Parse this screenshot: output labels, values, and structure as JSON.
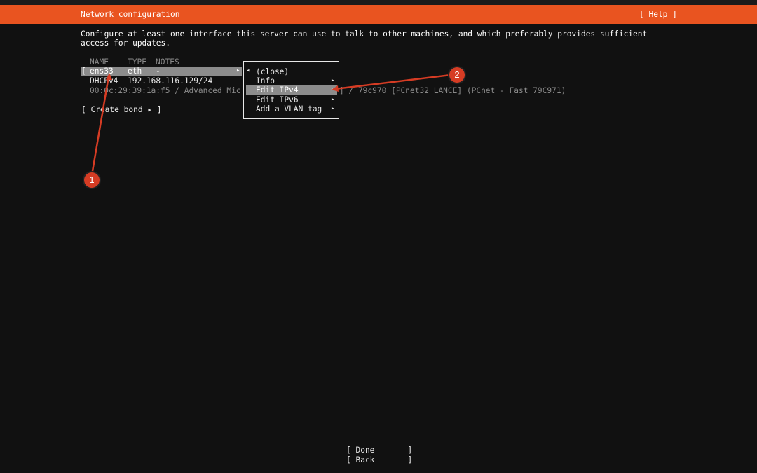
{
  "header": {
    "title": "Network configuration",
    "help": "[ Help ]"
  },
  "description": {
    "line1": "Configure at least one interface this server can use to talk to other machines, and which preferably provides sufficient",
    "line2": "access for updates."
  },
  "table": {
    "col_name": "NAME",
    "col_type": "TYPE",
    "col_notes": "NOTES",
    "interface": {
      "open_bracket": "[",
      "name": "ens33",
      "type": "eth",
      "notes": "-",
      "arrow": "▸"
    },
    "dhcp_label": "DHCPv4",
    "dhcp_address": "192.168.116.129/24",
    "mac_line_left": "00:0c:29:39:1a:f5 / Advanced Mic",
    "mac_line_right": "] / 79c970 [PCnet32 LANCE] (PCnet - Fast 79C971)"
  },
  "create_bond": "[ Create bond ▸ ]",
  "popup": {
    "close_arrow": "◂",
    "items": [
      {
        "label": "(close)",
        "arrow": ""
      },
      {
        "label": "Info",
        "arrow": "▸"
      },
      {
        "label": "Edit IPv4",
        "arrow": "▸"
      },
      {
        "label": "Edit IPv6",
        "arrow": "▸"
      },
      {
        "label": "Add a VLAN tag",
        "arrow": "▸"
      }
    ]
  },
  "footer": {
    "done": "[ Done       ]",
    "back": "[ Back       ]"
  },
  "annotations": {
    "badge1": "1",
    "badge2": "2",
    "color": "#d63c24"
  }
}
